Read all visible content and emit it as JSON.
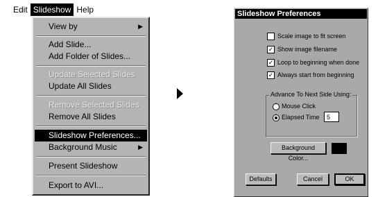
{
  "menubar": {
    "items": [
      {
        "label": "Edit"
      },
      {
        "label": "Slideshow"
      },
      {
        "label": "Help"
      }
    ]
  },
  "dropdown": {
    "items": [
      {
        "label": "View by",
        "submenu": true
      },
      {
        "label": "Add Slide..."
      },
      {
        "label": "Add Folder of Slides..."
      },
      {
        "label": "Update Selected Slides",
        "disabled": true
      },
      {
        "label": "Update All Slides"
      },
      {
        "label": "Remove Selected Slides",
        "disabled": true
      },
      {
        "label": "Remove All Slides"
      },
      {
        "label": "Slideshow Preferences...",
        "highlighted": true
      },
      {
        "label": "Background Music",
        "submenu": true
      },
      {
        "label": "Present Slideshow"
      },
      {
        "label": "Export to AVI..."
      }
    ],
    "submenu_arrow": "▶"
  },
  "dialog": {
    "title": "Slideshow Preferences",
    "checkboxes": [
      {
        "label": "Scale image to fit screen",
        "checked": false
      },
      {
        "label": "Show image filename",
        "checked": true
      },
      {
        "label": "Loop to beginning when done",
        "checked": true
      },
      {
        "label": "Always start from beginning",
        "checked": true
      }
    ],
    "check_mark": "✓",
    "advance_group": {
      "title": "Advance To Next Side Using:",
      "mouse_click": "Mouse Click",
      "elapsed_time": "Elapsed Time",
      "selected": "elapsed_time",
      "seconds": "5"
    },
    "background_color_label": "Background Color...",
    "background_color_value": "#000000",
    "buttons": {
      "defaults": "Defaults",
      "cancel": "Cancel",
      "ok": "OK"
    }
  }
}
